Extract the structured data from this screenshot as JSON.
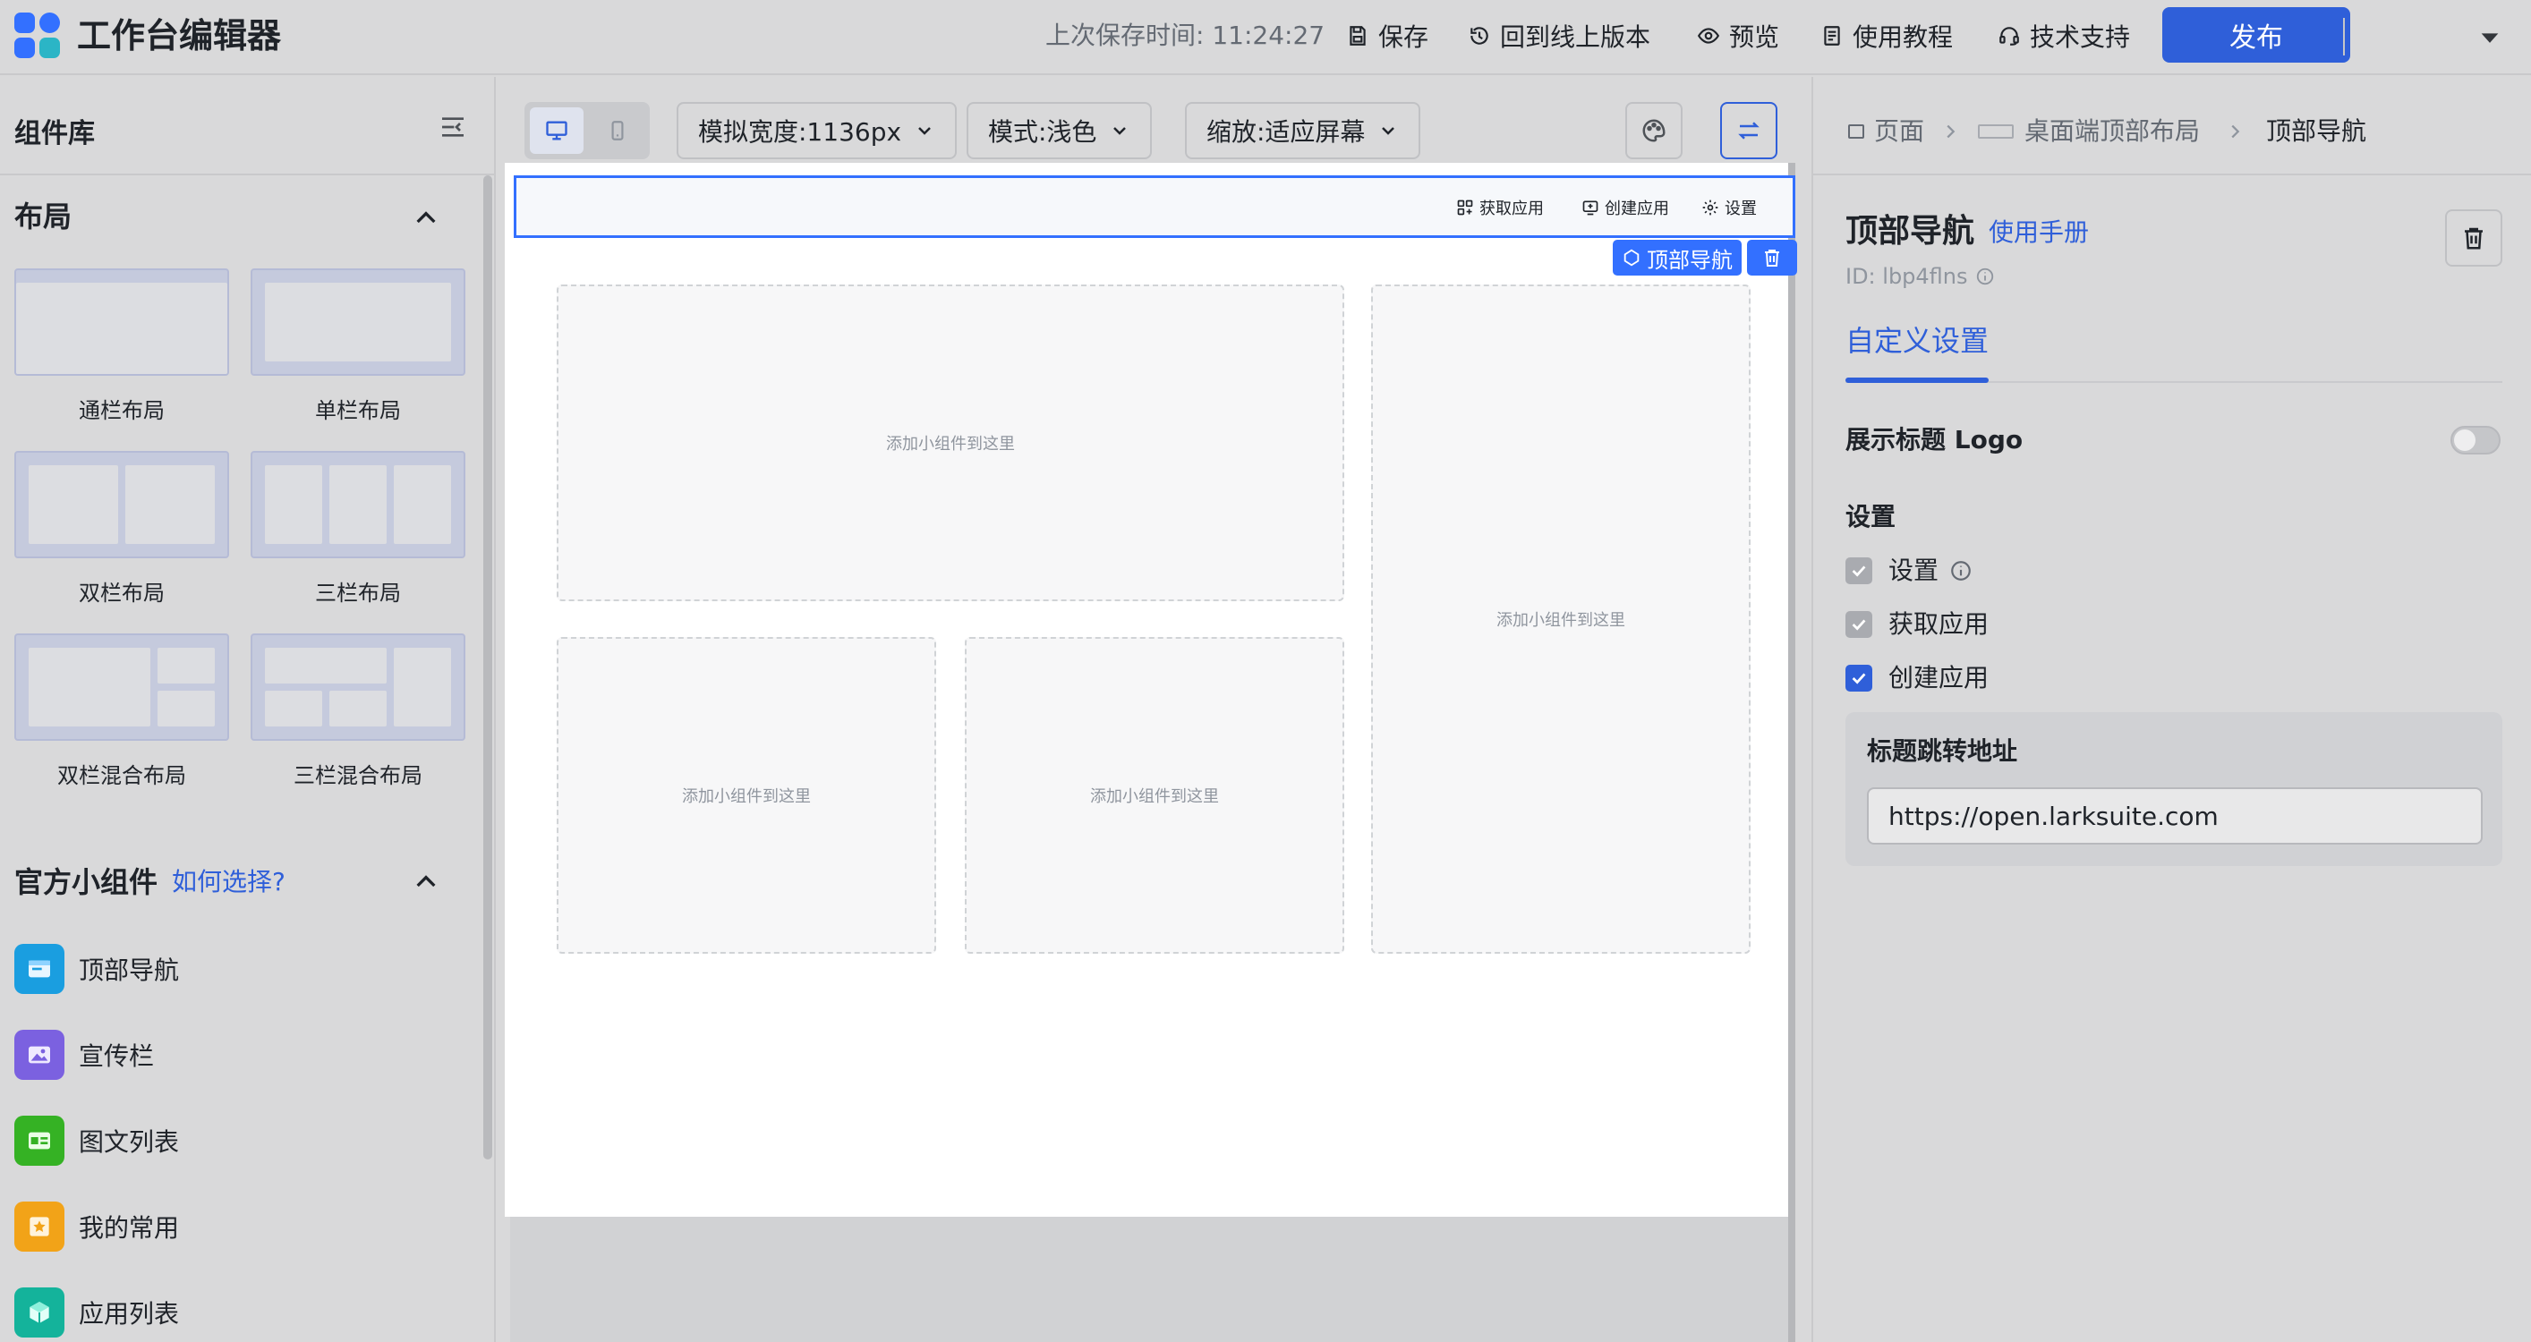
{
  "app": {
    "title": "工作台编辑器"
  },
  "topbar": {
    "save_time": "上次保存时间: 11:24:27",
    "save_label": "保存",
    "rollback_label": "回到线上版本",
    "preview_label": "预览",
    "tutorial_label": "使用教程",
    "support_label": "技术支持",
    "publish_label": "发布"
  },
  "sidebar": {
    "title": "组件库",
    "layout_section": "布局",
    "layouts": [
      {
        "label": "通栏布局",
        "icon": "layout-full-icon"
      },
      {
        "label": "单栏布局",
        "icon": "layout-single-icon"
      },
      {
        "label": "双栏布局",
        "icon": "layout-two-col-icon"
      },
      {
        "label": "三栏布局",
        "icon": "layout-three-col-icon"
      },
      {
        "label": "双栏混合布局",
        "icon": "layout-two-mixed-icon"
      },
      {
        "label": "三栏混合布局",
        "icon": "layout-three-mixed-icon"
      }
    ],
    "widget_section": "官方小组件",
    "widget_help": "如何选择?",
    "widgets": [
      {
        "label": "顶部导航",
        "icon": "top-nav-icon",
        "color": "#1a9ee0"
      },
      {
        "label": "宣传栏",
        "icon": "banner-icon",
        "color": "#7b61e0"
      },
      {
        "label": "图文列表",
        "icon": "image-text-list-icon",
        "color": "#35b224"
      },
      {
        "label": "我的常用",
        "icon": "favorites-icon",
        "color": "#f2a318"
      },
      {
        "label": "应用列表",
        "icon": "app-list-icon",
        "color": "#14b39b"
      }
    ]
  },
  "toolbar": {
    "width_label": "模拟宽度:1136px",
    "mode_label": "模式:浅色",
    "zoom_label": "缩放:适应屏幕"
  },
  "preview": {
    "nav_items": [
      "获取应用",
      "创建应用",
      "设置"
    ],
    "selected_tag": "顶部导航",
    "slot_text": "添加小组件到这里"
  },
  "panel": {
    "crumbs": [
      "页面",
      "桌面端顶部布局",
      "顶部导航"
    ],
    "title": "顶部导航",
    "manual_link": "使用手册",
    "id_text": "ID: lbp4flns",
    "tab": "自定义设置",
    "show_logo_label": "展示标题 Logo",
    "show_logo_on": false,
    "settings_label": "设置",
    "checkboxes": [
      {
        "label": "设置",
        "checked": true,
        "disabled": true
      },
      {
        "label": "获取应用",
        "checked": true,
        "disabled": true
      },
      {
        "label": "创建应用",
        "checked": true,
        "disabled": false
      }
    ],
    "url_label": "标题跳转地址",
    "url_value": "https://open.larksuite.com"
  },
  "colors": {
    "accent": "#2f5fd9",
    "selection": "#3370ff"
  }
}
